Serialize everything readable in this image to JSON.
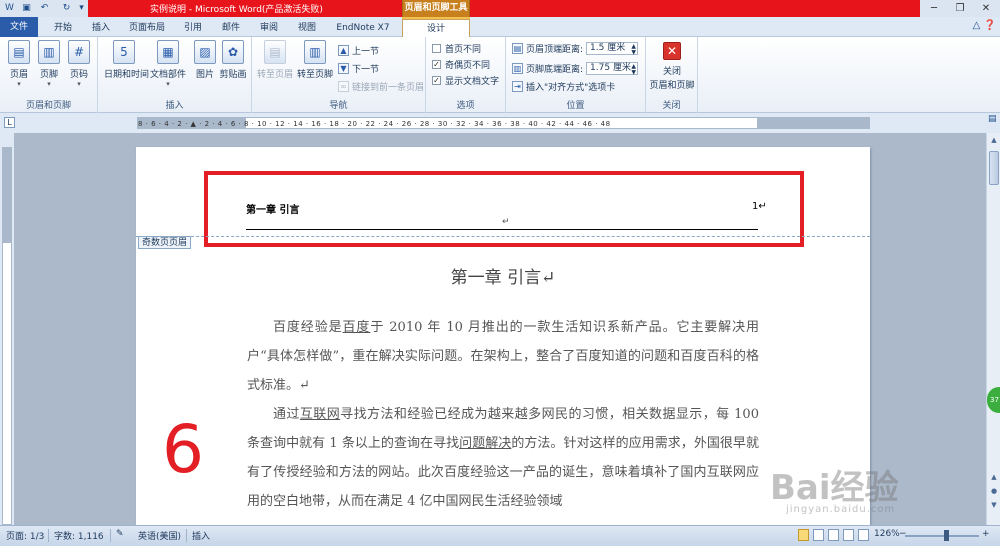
{
  "titlebar": {
    "title": "实例说明 - Microsoft Word(产品激活失败)",
    "context_tools": "页眉和页脚工具",
    "minimize": "─",
    "restore": "❐",
    "close": "✕"
  },
  "tabs": {
    "file": "文件",
    "items": [
      "开始",
      "插入",
      "页面布局",
      "引用",
      "邮件",
      "审阅",
      "视图",
      "EndNote X7",
      "设计"
    ]
  },
  "ribbon": {
    "group_header_footer": {
      "label": "页眉和页脚",
      "header": "页眉",
      "footer": "页脚",
      "page_number": "页码"
    },
    "group_insert": {
      "label": "插入",
      "datetime": "日期和时间",
      "quickparts": "文档部件",
      "picture": "图片",
      "clipart": "剪贴画"
    },
    "group_nav": {
      "label": "导航",
      "goto_header": "转至页眉",
      "goto_footer": "转至页脚",
      "prev": "上一节",
      "next": "下一节",
      "link_prev": "链接到前一条页眉"
    },
    "group_options": {
      "label": "选项",
      "first_page": "首页不同",
      "odd_even": "奇偶页不同",
      "show_text": "显示文档文字"
    },
    "group_position": {
      "label": "位置",
      "header_top": "页眉顶端距离:",
      "header_top_value": "1.5 厘米",
      "footer_bottom": "页脚底端距离:",
      "footer_bottom_value": "1.75 厘米",
      "align_tab": "插入\"对齐方式\"选项卡"
    },
    "group_close": {
      "label": "关闭",
      "close_line1": "关闭",
      "close_line2": "页眉和页脚"
    }
  },
  "ruler": {
    "ticks": "8 · 6 · 4 · 2 · ▲ · 2 · 4 · 6 · 8 · 10 · 12 · 14 · 16 · 18 · 20 · 22 · 24 · 26 · 28 · 30 · 32 · 34 · 36 · 38 · 40 · 42 · 44 · 46 · 48"
  },
  "document": {
    "header_left": "第一章  引言",
    "header_right": "1↵",
    "header_mark": "↵",
    "header_tag": "奇数页页眉",
    "chapter_title": "第一章  引言↵",
    "para1_a": "百度经验是",
    "para1_link": "百度",
    "para1_b": "于 2010 年 10 月推出的一款生活知识系新产品。它主要解决用户“具体怎样做”，重在解决实际问题。在架构上，整合了百度知道的问题和百度百科的格式标准。↵",
    "para2_a": "通过",
    "para2_link1": "互联网",
    "para2_b": "寻找方法和经验已经成为越来越多网民的习惯，相关数据显示，每 100 条查询中就有 1 条以上的查询在寻找",
    "para2_link2": "问题解决",
    "para2_c": "的方法。针对这样的应用需求，外国很早就有了传授经验和方法的网站。此次百度经验这一产品的诞生，意味着填补了国内互联网应用的空白地带，从而在满足 4 亿中国网民生活经验领域",
    "big_number": "6"
  },
  "watermark": {
    "text": "Bai经验",
    "sub": "jingyan.baidu.com"
  },
  "scroll_badge": "37",
  "statusbar": {
    "page": "页面: 1/3",
    "words": "字数: 1,116",
    "language": "英语(美国)",
    "mode": "插入",
    "zoom": "126%"
  }
}
